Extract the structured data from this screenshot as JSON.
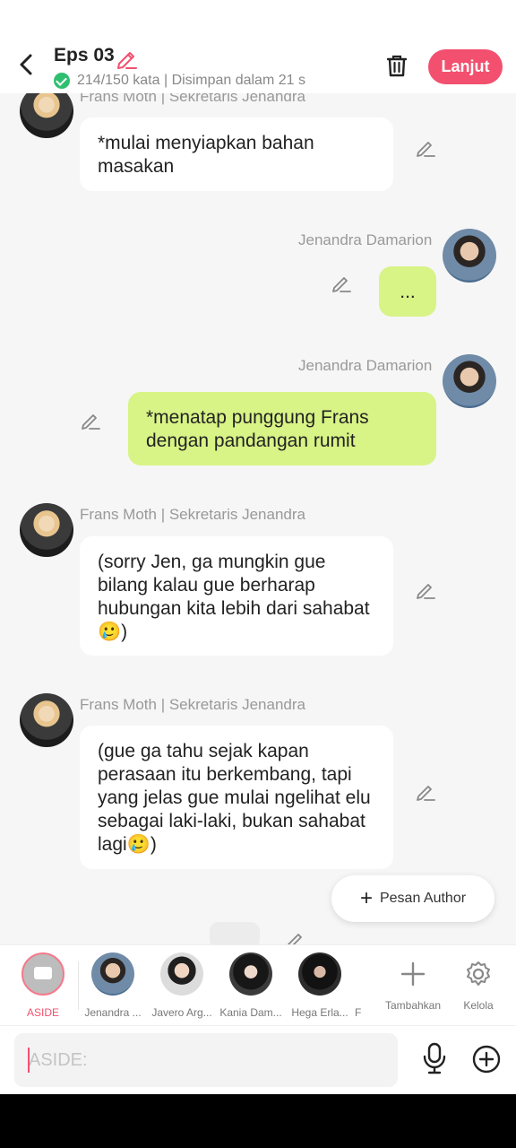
{
  "header": {
    "title": "Eps 03",
    "subtitle": "214/150 kata | Disimpan dalam 21 s",
    "next_label": "Lanjut"
  },
  "messages": [
    {
      "sender": "Frans Moth | Sekretaris Jenandra",
      "text": "*mulai menyiapkan bahan masakan"
    },
    {
      "sender": "Jenandra Damarion",
      "text": "..."
    },
    {
      "sender": "Jenandra Damarion",
      "text": "*menatap punggung Frans dengan pandangan rumit"
    },
    {
      "sender": "Frans Moth | Sekretaris Jenandra",
      "text": "(sorry Jen, ga mungkin gue bilang kalau gue berharap hubungan kita lebih dari sahabat 🥲)"
    },
    {
      "sender": "Frans Moth | Sekretaris Jenandra",
      "text": "(gue ga tahu sejak kapan perasaan itu berkembang, tapi yang jelas gue mulai ngelihat elu sebagai laki-laki, bukan sahabat lagi🥲)"
    }
  ],
  "pesan_author_label": "Pesan Author",
  "characters": [
    {
      "label": "ASIDE"
    },
    {
      "label": "Jenandra ..."
    },
    {
      "label": "Javero Arg..."
    },
    {
      "label": "Kania Dam..."
    },
    {
      "label": "Hega Erla..."
    },
    {
      "label": "F"
    }
  ],
  "tools": {
    "add_label": "Tambahkan",
    "manage_label": "Kelola"
  },
  "input": {
    "placeholder": "ASIDE:"
  },
  "colors": {
    "accent": "#f2506e",
    "right_bubble": "#d8f386",
    "left_bubble": "#ffffff"
  }
}
